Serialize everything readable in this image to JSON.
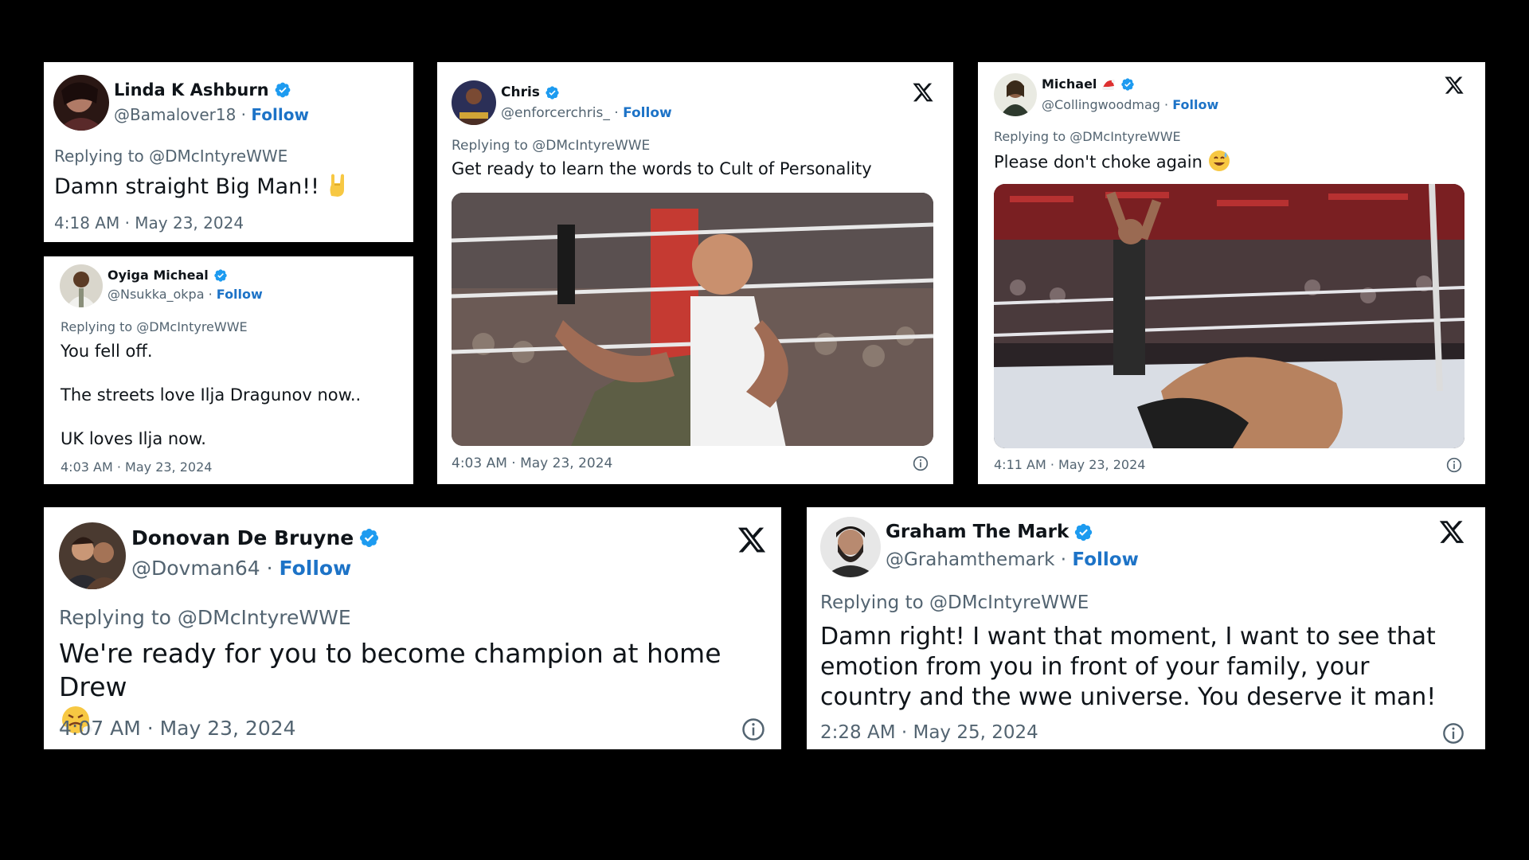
{
  "verified_color": "#1d9bf0",
  "follow_color": "#1d73c7",
  "tweets": [
    {
      "name": "Linda K Ashburn",
      "handle": "@Bamalover18",
      "follow": "Follow",
      "replying": "Replying to @DMcIntyreWWE",
      "text": "Damn straight Big Man!!",
      "emoji": "rock-hand-emoji",
      "time": "4:18 AM · May 23, 2024"
    },
    {
      "name": "Oyiga Micheal",
      "handle": "@Nsukka_okpa",
      "follow": "Follow",
      "replying": "Replying to @DMcIntyreWWE",
      "lines": [
        "You fell off.",
        "The streets love Ilja Dragunov now..",
        "UK loves Ilja now."
      ],
      "time": "4:03 AM · May 23, 2024"
    },
    {
      "name": "Chris",
      "handle": "@enforcerchris_",
      "follow": "Follow",
      "replying": "Replying to @DMcIntyreWWE",
      "text": "Get ready to learn the words to Cult of Personality",
      "image": "cm-punk-ring-photo",
      "time": "4:03 AM · May 23, 2024"
    },
    {
      "name": "Michael",
      "handle": "@Collingwoodmag",
      "follow": "Follow",
      "replying": "Replying to @DMcIntyreWWE",
      "text": "Please don't choke again",
      "emoji": "sweat-smile-emoji",
      "image": "wrestling-ring-title-photo",
      "time": "4:11 AM · May 23, 2024"
    },
    {
      "name": "Donovan De Bruyne",
      "handle": "@Dovman64",
      "follow": "Follow",
      "replying": "Replying to @DMcIntyreWWE",
      "text": "We're ready for you to become champion at home Drew",
      "emoji": "steam-nose-emoji",
      "time": "4:07 AM · May 23, 2024"
    },
    {
      "name": "Graham The Mark",
      "handle": "@Grahamthemark",
      "follow": "Follow",
      "replying": "Replying to @DMcIntyreWWE",
      "text": "Damn right! I want that moment, I want to see that emotion from you in front of your family, your country and the wwe universe. You deserve it man!",
      "time": "2:28 AM · May 25, 2024"
    }
  ]
}
